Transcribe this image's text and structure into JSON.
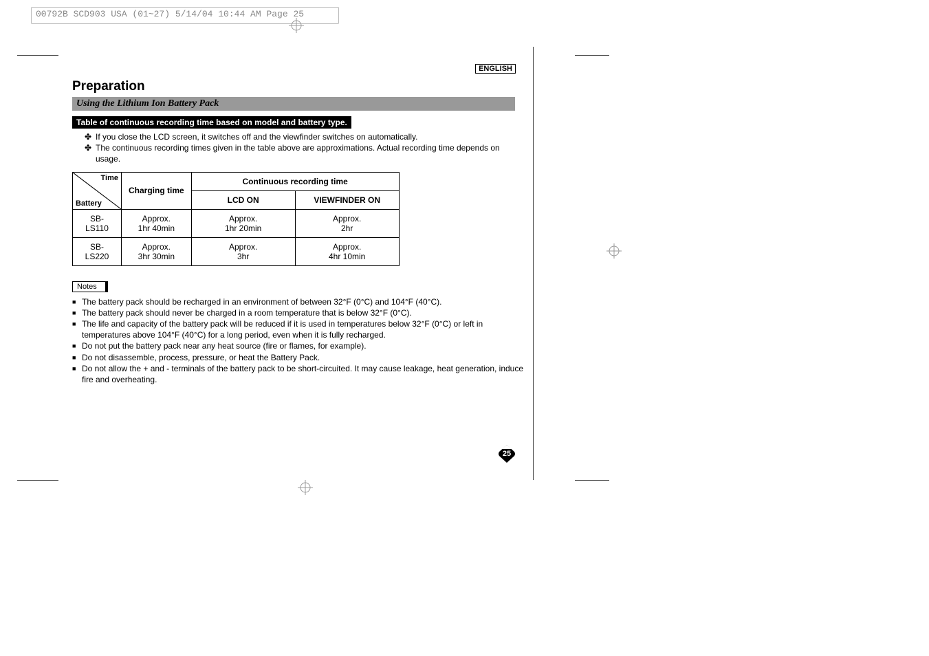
{
  "meta_header": "00792B SCD903 USA (01~27)  5/14/04 10:44 AM  Page 25",
  "language_label": "ENGLISH",
  "title": "Preparation",
  "subtitle": "Using the Lithium Ion Battery Pack",
  "table_caption": "Table of continuous recording time based on model and battery type.",
  "intro_bullets": [
    "If you close the LCD screen, it switches off and the viewfinder switches on automatically.",
    "The continuous recording times given in the table above are approximations. Actual recording time depends on usage."
  ],
  "table": {
    "diag_top": "Time",
    "diag_bottom": "Battery",
    "col_charging": "Charging time",
    "col_group": "Continuous recording time",
    "col_lcd": "LCD ON",
    "col_vf": "VIEWFINDER ON",
    "rows": [
      {
        "battery": "SB-LS110",
        "charging": "Approx.\n1hr 40min",
        "lcd": "Approx.\n1hr 20min",
        "vf": "Approx.\n2hr"
      },
      {
        "battery": "SB-LS220",
        "charging": "Approx.\n3hr 30min",
        "lcd": "Approx.\n3hr",
        "vf": "Approx.\n4hr 10min"
      }
    ]
  },
  "notes_label": "Notes",
  "notes": [
    "The battery pack should be recharged in an environment of between 32°F (0°C) and 104°F (40°C).",
    "The battery pack should never be charged in a room temperature that is below 32°F (0°C).",
    "The life and capacity of the battery pack will be reduced if it is used in temperatures below 32°F (0°C) or left in temperatures above 104°F (40°C) for a long period, even when it is fully recharged.",
    "Do not put the battery pack near any heat source (fire or flames, for example).",
    "Do not disassemble, process, pressure, or heat the Battery Pack.",
    "Do not allow the + and - terminals of the battery pack to be short-circuited. It may cause leakage, heat generation, induce fire and overheating."
  ],
  "page_number": "25"
}
